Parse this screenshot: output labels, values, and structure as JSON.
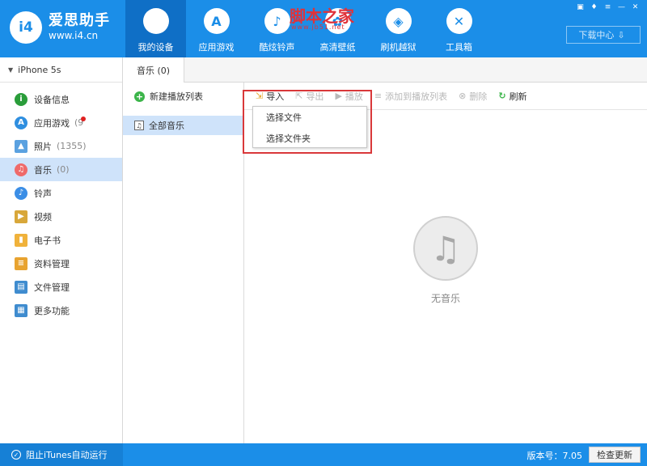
{
  "app": {
    "name": "爱思助手",
    "url": "www.i4.cn",
    "logo_mark": "i4"
  },
  "watermark": {
    "title": "脚本之家",
    "subtitle": "www.jb51.net"
  },
  "nav": [
    {
      "label": "我的设备",
      "icon": "apple-icon",
      "glyph": "",
      "active": true
    },
    {
      "label": "应用游戏",
      "icon": "app-store-icon",
      "glyph": "A",
      "active": false
    },
    {
      "label": "酷炫铃声",
      "icon": "bell-icon",
      "glyph": "♪",
      "active": false
    },
    {
      "label": "高清壁纸",
      "icon": "flower-icon",
      "glyph": "✿",
      "active": false
    },
    {
      "label": "刷机越狱",
      "icon": "box-icon",
      "glyph": "◈",
      "active": false
    },
    {
      "label": "工具箱",
      "icon": "tools-icon",
      "glyph": "✕",
      "active": false
    }
  ],
  "window_controls": [
    "▣",
    "♦",
    "≡",
    "—",
    "✕"
  ],
  "download_center": {
    "label": "下载中心",
    "icon": "download-icon",
    "glyph": "⇩"
  },
  "device": {
    "name": "iPhone 5s",
    "caret": "▼"
  },
  "sidebar": {
    "items": [
      {
        "label": "设备信息",
        "count": "",
        "icon": "info-icon",
        "glyph": "i",
        "color": "#2a9d3a",
        "round": true,
        "active": false
      },
      {
        "label": "应用游戏",
        "count": "(9",
        "icon": "app-store-icon",
        "glyph": "A",
        "color": "#2f8fe0",
        "round": true,
        "active": false,
        "badge": true
      },
      {
        "label": "照片",
        "count": "(1355)",
        "icon": "photo-icon",
        "glyph": "▲",
        "color": "#5aa1e0",
        "round": false,
        "active": false
      },
      {
        "label": "音乐",
        "count": "(0)",
        "icon": "music-icon",
        "glyph": "♫",
        "color": "#ef6a6a",
        "round": true,
        "active": true
      },
      {
        "label": "铃声",
        "count": "",
        "icon": "bell-icon",
        "glyph": "♪",
        "color": "#3b8ee6",
        "round": true,
        "active": false
      },
      {
        "label": "视频",
        "count": "",
        "icon": "video-icon",
        "glyph": "▶",
        "color": "#d8a73a",
        "round": false,
        "active": false
      },
      {
        "label": "电子书",
        "count": "",
        "icon": "book-icon",
        "glyph": "▮",
        "color": "#f0b23b",
        "round": false,
        "active": false
      },
      {
        "label": "资料管理",
        "count": "",
        "icon": "contacts-icon",
        "glyph": "≡",
        "color": "#e8a330",
        "round": false,
        "active": false
      },
      {
        "label": "文件管理",
        "count": "",
        "icon": "file-icon",
        "glyph": "▤",
        "color": "#3f8ccf",
        "round": false,
        "active": false
      },
      {
        "label": "更多功能",
        "count": "",
        "icon": "more-icon",
        "glyph": "▦",
        "color": "#3f8ccf",
        "round": false,
        "active": false
      }
    ]
  },
  "tab": {
    "label": "音乐 (0)"
  },
  "playlist": {
    "new_label": "新建播放列表",
    "all_label": "全部音乐"
  },
  "toolbar": [
    {
      "label": "导入",
      "icon": "import-icon",
      "glyph": "⇲",
      "state": "import"
    },
    {
      "label": "导出",
      "icon": "export-icon",
      "glyph": "⇱",
      "state": "disabled"
    },
    {
      "label": "播放",
      "icon": "play-icon",
      "glyph": "▶",
      "state": "disabled"
    },
    {
      "label": "添加到播放列表",
      "icon": "add-to-playlist-icon",
      "glyph": "≡",
      "state": "disabled"
    },
    {
      "label": "删除",
      "icon": "delete-icon",
      "glyph": "⊗",
      "state": "disabled"
    },
    {
      "label": "刷新",
      "icon": "refresh-icon",
      "glyph": "↻",
      "state": "refresh"
    }
  ],
  "dropdown": {
    "items": [
      "选择文件",
      "选择文件夹"
    ]
  },
  "empty": {
    "text": "无音乐",
    "glyph": "♫"
  },
  "bottom": {
    "itunes_label": "阻止iTunes自动运行",
    "version": "版本号：7.05",
    "update_label": "检查更新"
  }
}
